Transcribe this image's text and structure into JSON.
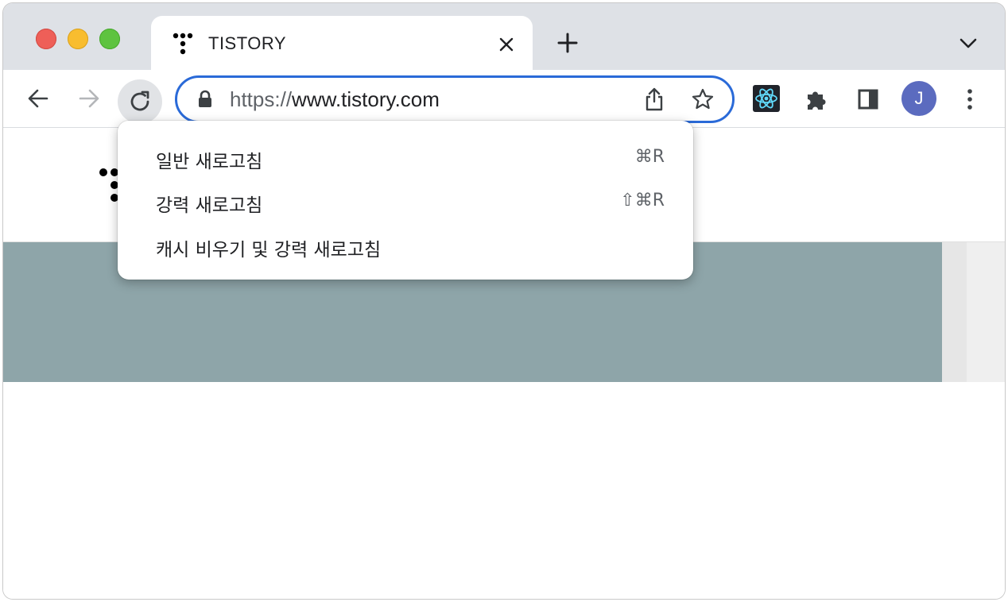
{
  "tab": {
    "title": "TISTORY",
    "favicon": "tistory-dots-icon"
  },
  "toolbar": {
    "url_scheme": "https://",
    "url_host": "www.tistory.com",
    "profile_initial": "J"
  },
  "reload_menu": {
    "items": [
      {
        "label": "일반 새로고침",
        "shortcut": "⌘R"
      },
      {
        "label": "강력 새로고침",
        "shortcut": "⇧⌘R"
      },
      {
        "label": "캐시 비우기 및 강력 새로고침",
        "shortcut": ""
      }
    ]
  },
  "colors": {
    "accent": "#2a6ad8",
    "tabstrip": "#dee1e6",
    "banner": "#8ea5a9",
    "avatar": "#5b6bbf"
  }
}
